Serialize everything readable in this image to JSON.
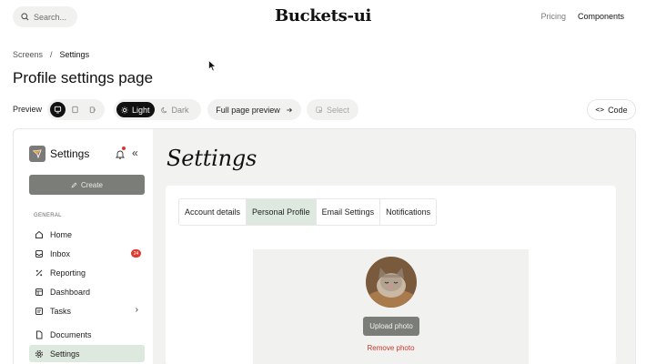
{
  "topnav": {
    "search_placeholder": "Search...",
    "brand": "Buckets-ui",
    "links": [
      "Pricing",
      "Components"
    ]
  },
  "breadcrumb": [
    "Screens",
    "/",
    "Settings"
  ],
  "page_title": "Profile settings page",
  "toolbar": {
    "preview_label": "Preview",
    "devices": [
      "desktop-icon",
      "tablet-icon",
      "mobile-icon"
    ],
    "theme_light": "Light",
    "theme_dark": "Dark",
    "full_page_preview": "Full page preview",
    "select": "Select",
    "code": "Code"
  },
  "app": {
    "sidebar": {
      "title": "Settings",
      "create": "Create",
      "section": "GENERAL",
      "items": [
        {
          "label": "Home",
          "icon": "home-icon"
        },
        {
          "label": "Inbox",
          "icon": "inbox-icon",
          "badge": "24"
        },
        {
          "label": "Reporting",
          "icon": "percent-icon"
        },
        {
          "label": "Dashboard",
          "icon": "dashboard-icon"
        },
        {
          "label": "Tasks",
          "icon": "tasks-icon"
        },
        {
          "label": "Documents",
          "icon": "document-icon"
        },
        {
          "label": "Settings",
          "icon": "gear-icon"
        }
      ]
    },
    "main": {
      "title": "Settings",
      "tabs": [
        "Account details",
        "Personal Profile",
        "Email Settings",
        "Notifications"
      ],
      "active_tab": "Personal Profile",
      "upload_photo": "Upload photo",
      "remove_photo": "Remove photo"
    }
  },
  "colors": {
    "accent_green": "#dde8de",
    "button_gray": "#7b7d78",
    "danger": "#c8382d",
    "badge": "#dc3b32"
  }
}
